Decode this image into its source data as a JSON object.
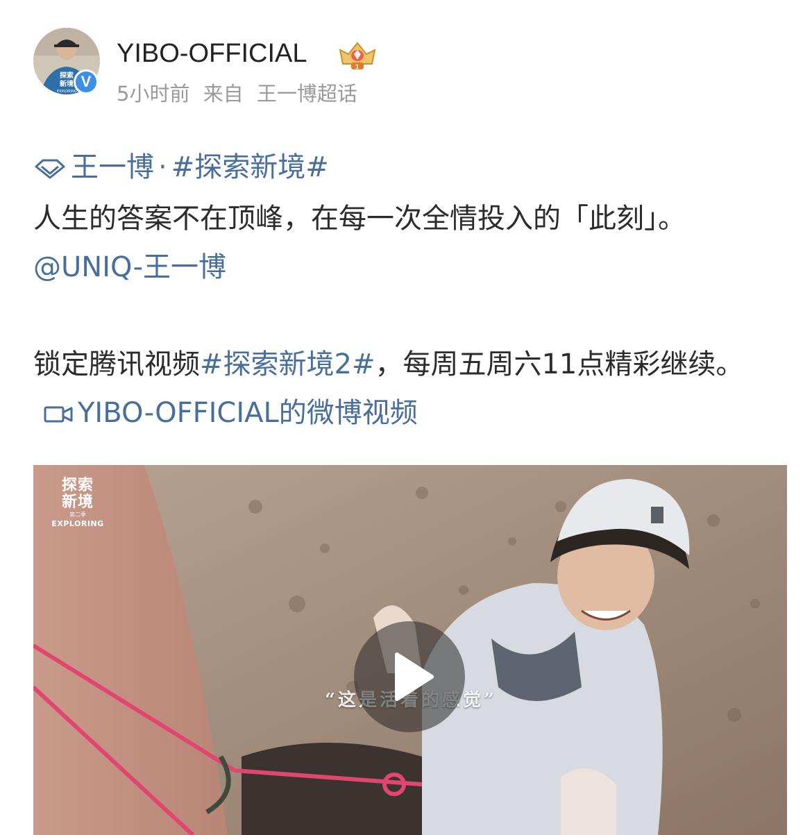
{
  "post": {
    "username": "YIBO-OFFICIAL",
    "time": "5小时前",
    "source_prefix": "来自",
    "source": "王一博超话",
    "verified_mark": "V",
    "avatar_text": {
      "line1": "探索",
      "line2": "新境",
      "line3": "EXPLORING"
    },
    "topic": {
      "name": "王一博",
      "separator": "·",
      "hashtag": "#探索新境#"
    },
    "content": {
      "line1": "人生的答案不在顶峰，在每一次全情投入的「此刻」。",
      "mention": "@UNIQ-王一博",
      "line2_prefix": "锁定腾讯视频",
      "hashtag2": "#探索新境2#",
      "line2_suffix": "，每周五周六11点精彩继续。",
      "video_link": "YIBO-OFFICIAL的微博视频"
    },
    "video": {
      "logo_line1": "探索",
      "logo_line2": "新境",
      "logo_sub": "第二季",
      "logo_en": "EXPLORING",
      "caption": "“这是活着的感觉”"
    }
  },
  "colors": {
    "link": "#476e9c",
    "text": "#2b2b2b",
    "meta": "#9a9a9a",
    "verified": "#3d8ee6"
  },
  "icons": [
    "diamond-icon",
    "video-camera-icon",
    "crown-badge-icon",
    "play-icon"
  ]
}
